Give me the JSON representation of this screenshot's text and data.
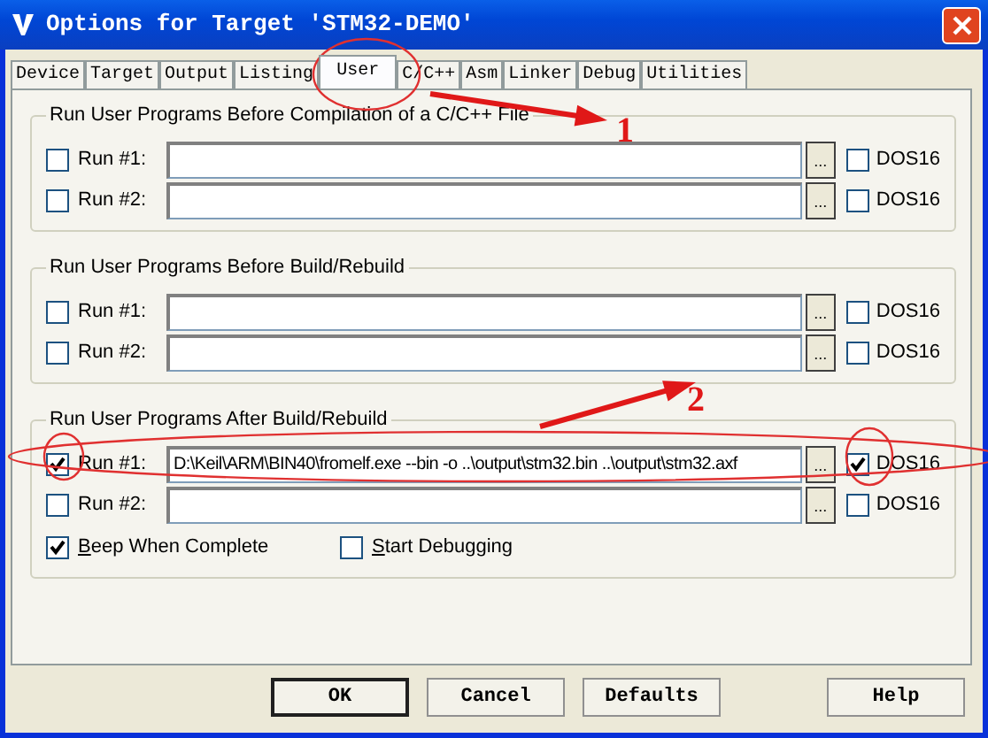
{
  "window": {
    "title": "Options for Target 'STM32-DEMO'"
  },
  "tabs": [
    {
      "label": "Device",
      "selected": false
    },
    {
      "label": "Target",
      "selected": false
    },
    {
      "label": "Output",
      "selected": false
    },
    {
      "label": "Listing",
      "selected": false
    },
    {
      "label": "User",
      "selected": true
    },
    {
      "label": "C/C++",
      "selected": false
    },
    {
      "label": "Asm",
      "selected": false
    },
    {
      "label": "Linker",
      "selected": false
    },
    {
      "label": "Debug",
      "selected": false
    },
    {
      "label": "Utilities",
      "selected": false
    }
  ],
  "groups": [
    {
      "title": "Run User Programs Before Compilation of a C/C++ File",
      "rows": [
        {
          "label": "Run #1:",
          "checked": false,
          "browse": "...",
          "dos16_label": "DOS16",
          "dos16": false
        },
        {
          "label": "Run #2:",
          "checked": false,
          "browse": "...",
          "dos16_label": "DOS16",
          "dos16": false
        }
      ]
    },
    {
      "title": "Run User Programs Before Build/Rebuild",
      "rows": [
        {
          "label": "Run #1:",
          "checked": false,
          "browse": "...",
          "dos16_label": "DOS16",
          "dos16": false
        },
        {
          "label": "Run #2:",
          "checked": false,
          "browse": "...",
          "dos16_label": "DOS16",
          "dos16": false
        }
      ]
    },
    {
      "title": "Run User Programs After Build/Rebuild",
      "rows": [
        {
          "label": "Run #1:",
          "checked": true,
          "command": "D:\\Keil\\ARM\\BIN40\\fromelf.exe --bin -o ..\\output\\stm32.bin  ..\\output\\stm32.axf",
          "browse": "...",
          "dos16_label": "DOS16",
          "dos16": true
        },
        {
          "label": "Run #2:",
          "checked": false,
          "browse": "...",
          "dos16_label": "DOS16",
          "dos16": false
        }
      ],
      "options": [
        {
          "label": "Beep When Complete",
          "checked": true
        },
        {
          "label": "Start Debugging",
          "checked": false
        }
      ]
    }
  ],
  "buttons": [
    "OK",
    "Cancel",
    "Defaults",
    "Help"
  ],
  "annotations": [
    {
      "label": "1"
    },
    {
      "label": "2"
    }
  ]
}
